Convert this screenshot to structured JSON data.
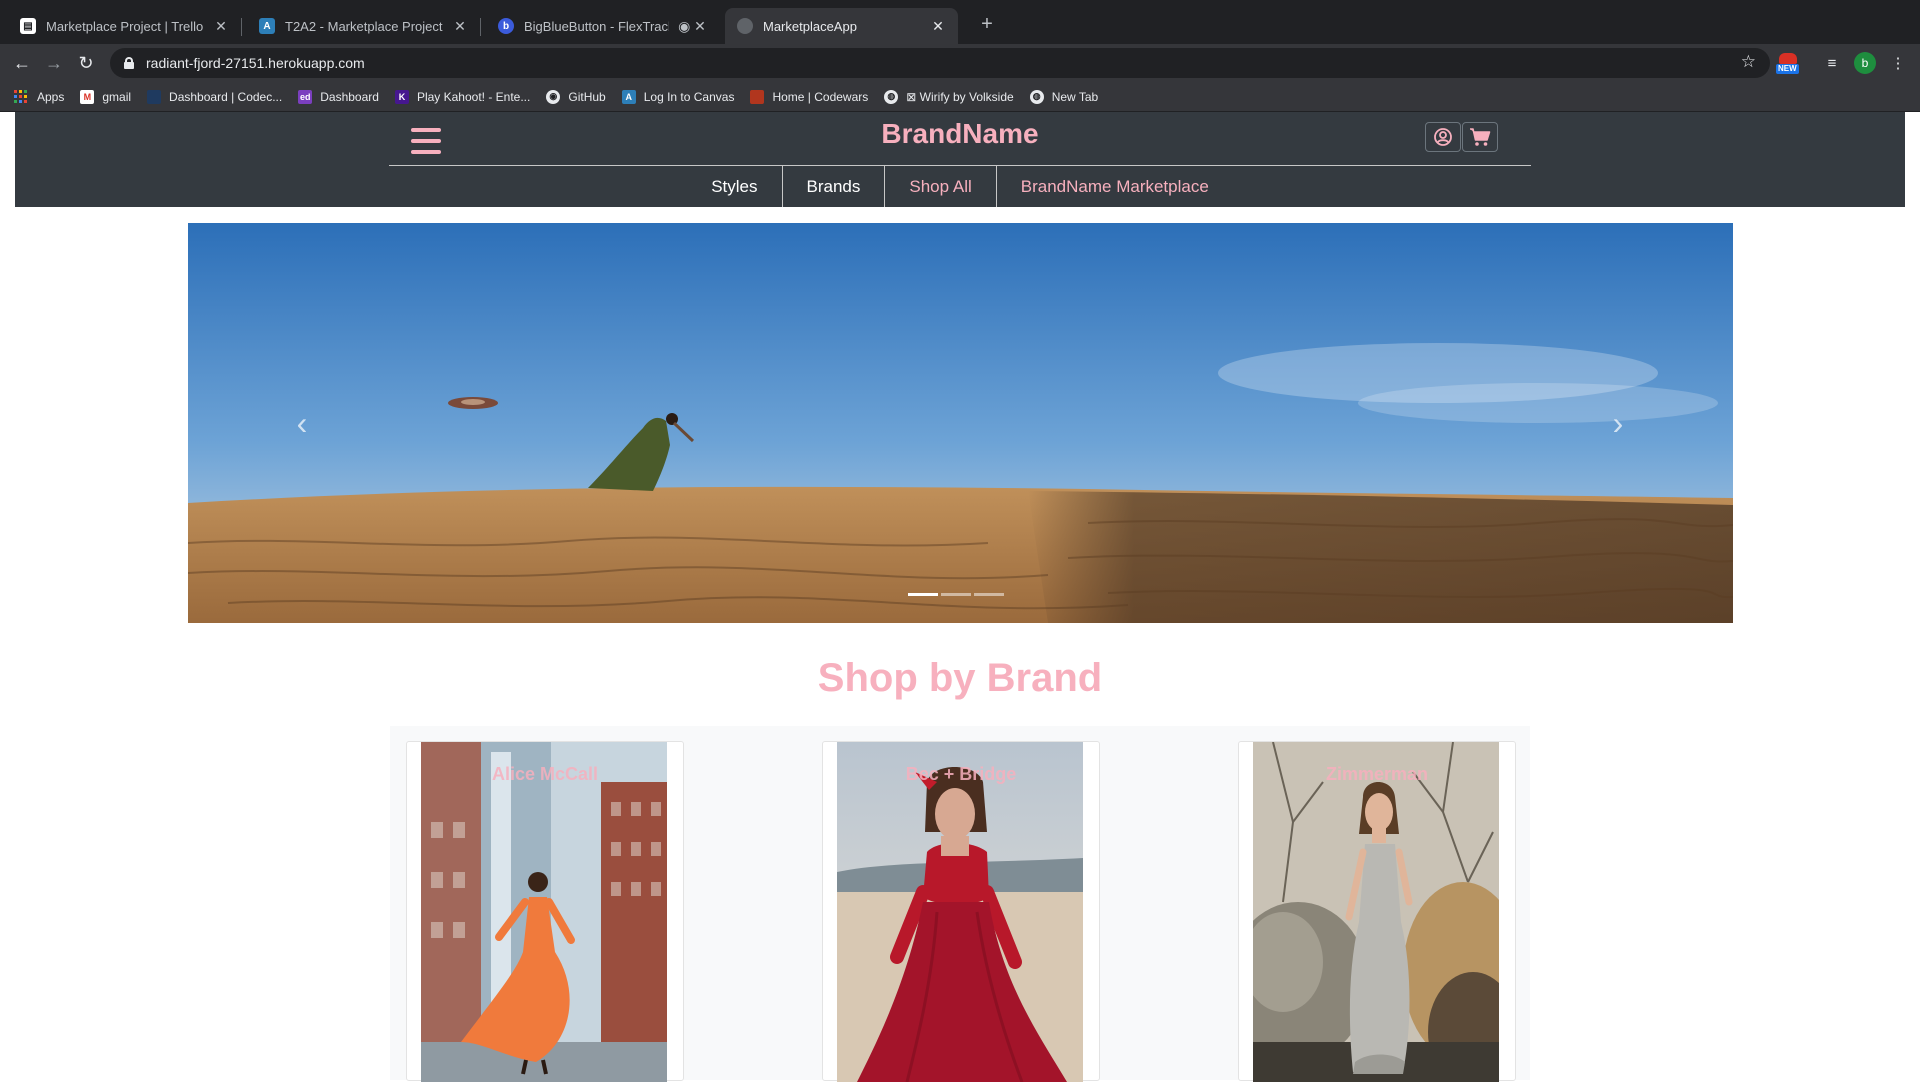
{
  "browser": {
    "tabs": [
      {
        "title": "Marketplace Project | Trello",
        "icon": "trello-icon",
        "active": false
      },
      {
        "title": "T2A2 - Marketplace Project",
        "icon": "canvas-icon",
        "active": false
      },
      {
        "title": "BigBlueButton - FlexTrack - ",
        "icon": "bigbluebutton-icon",
        "active": false
      },
      {
        "title": "MarketplaceApp",
        "icon": "globe-icon",
        "active": true
      }
    ],
    "url": "radiant-fjord-27151.herokuapp.com",
    "new_badge": "NEW",
    "profile_initial": "b",
    "bookmarks": [
      {
        "label": "Apps",
        "icon": "apps-grid-icon"
      },
      {
        "label": "gmail",
        "icon": "gmail-icon"
      },
      {
        "label": "Dashboard | Codec...",
        "icon": "codecademy-icon"
      },
      {
        "label": "Dashboard",
        "icon": "ed-icon"
      },
      {
        "label": "Play Kahoot! - Ente...",
        "icon": "kahoot-icon"
      },
      {
        "label": "GitHub",
        "icon": "github-icon"
      },
      {
        "label": "Log In to Canvas",
        "icon": "canvas-icon"
      },
      {
        "label": "Home | Codewars",
        "icon": "codewars-icon"
      },
      {
        "label": "⊠ Wirify by Volkside",
        "icon": "globe-icon"
      },
      {
        "label": "New Tab",
        "icon": "globe-icon"
      }
    ]
  },
  "header": {
    "brand": "BrandName",
    "nav": [
      {
        "label": "Styles",
        "highlight": false
      },
      {
        "label": "Brands",
        "highlight": false
      },
      {
        "label": "Shop All",
        "highlight": true
      },
      {
        "label": "BrandName Marketplace",
        "highlight": true
      }
    ]
  },
  "carousel": {
    "slide_count": 3,
    "active_slide": 1
  },
  "section": {
    "title": "Shop by Brand"
  },
  "brands": [
    {
      "name": "Alice McCall"
    },
    {
      "name": "Bec + Bridge"
    },
    {
      "name": "Zimmerman"
    }
  ],
  "colors": {
    "brand_pink": "#f7b0be",
    "header_bg": "#343a40",
    "chrome_dark": "#202124",
    "chrome_mid": "#35363a"
  }
}
